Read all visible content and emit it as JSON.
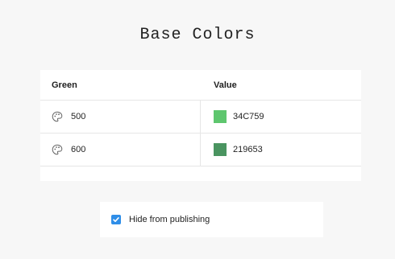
{
  "page": {
    "title": "Base Colors"
  },
  "table": {
    "headers": [
      "Green",
      "Value"
    ],
    "rows": [
      {
        "name": "500",
        "value": "34C759",
        "color": "#5ec66e"
      },
      {
        "name": "600",
        "value": "219653",
        "color": "#4a9460"
      }
    ]
  },
  "publish": {
    "label": "Hide from publishing",
    "checked": true,
    "accent": "#2f8ee8"
  },
  "icons": {
    "row_icon": "palette-icon",
    "check_icon": "check-icon"
  }
}
